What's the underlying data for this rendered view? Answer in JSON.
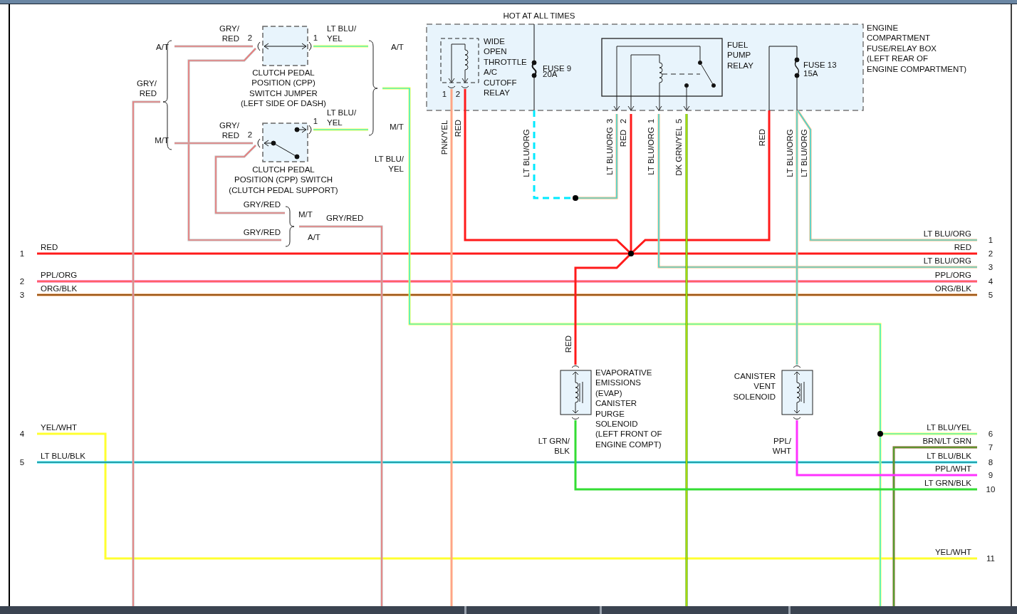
{
  "power_label": "HOT AT ALL TIMES",
  "components": [
    {
      "lines": [
        "CLUTCH PEDAL",
        "POSITION (CPP)",
        "SWITCH JUMPER",
        "(LEFT SIDE OF DASH)"
      ]
    },
    {
      "lines": [
        "CLUTCH PEDAL",
        "POSITION (CPP) SWITCH",
        "(CLUTCH PEDAL SUPPORT)"
      ]
    },
    {
      "lines": [
        "WIDE",
        "OPEN",
        "THROTTLE",
        "A/C",
        "CUTOFF",
        "RELAY"
      ]
    },
    {
      "lines": [
        "FUEL",
        "PUMP",
        "RELAY"
      ]
    },
    {
      "lines": [
        "ENGINE",
        "COMPARTMENT",
        "FUSE/RELAY BOX",
        "(LEFT REAR OF",
        "ENGINE COMPARTMENT)"
      ]
    },
    {
      "lines": [
        "EVAPORATIVE",
        "EMISSIONS",
        "(EVAP)",
        "CANISTER",
        "PURGE",
        "SOLENOID",
        "(LEFT FRONT OF",
        "ENGINE COMPT)"
      ]
    },
    {
      "lines": [
        "CANISTER",
        "VENT",
        "SOLENOID"
      ]
    }
  ],
  "fuses": [
    {
      "name": "FUSE 9",
      "rating": "20A"
    },
    {
      "name": "FUSE 13",
      "rating": "15A"
    }
  ],
  "wire_labels": [
    {
      "lines": [
        "GRY/",
        "RED"
      ]
    },
    {
      "lines": [
        "LT BLU/",
        "YEL"
      ]
    },
    {
      "lines": [
        "GRY/",
        "RED"
      ]
    },
    {
      "lines": [
        "GRY/",
        "RED"
      ]
    },
    {
      "lines": [
        "LT BLU/",
        "YEL"
      ]
    },
    {
      "lines": [
        "LT BLU/",
        "YEL"
      ]
    },
    {
      "lines": [
        "GRY/RED"
      ]
    },
    {
      "lines": [
        "GRY/RED"
      ]
    },
    {
      "lines": [
        "GRY/RED"
      ]
    },
    {
      "lines": [
        "PNK/YEL"
      ]
    },
    {
      "lines": [
        "RED"
      ]
    },
    {
      "lines": [
        "LT BLU/ORG"
      ]
    },
    {
      "lines": [
        "LT BLU/ORG"
      ]
    },
    {
      "lines": [
        "RED"
      ]
    },
    {
      "lines": [
        "LT BLU/ORG"
      ]
    },
    {
      "lines": [
        "DK GRN/YEL"
      ]
    },
    {
      "lines": [
        "RED"
      ]
    },
    {
      "lines": [
        "LT BLU/ORG"
      ]
    },
    {
      "lines": [
        "LT BLU/ORG"
      ]
    },
    {
      "lines": [
        "RED"
      ]
    },
    {
      "lines": [
        "LT GRN/",
        "BLK"
      ]
    },
    {
      "lines": [
        "PPL/",
        "WHT"
      ]
    }
  ],
  "pin_numbers": [
    "2",
    "1",
    "2",
    "1",
    "1",
    "2",
    "3",
    "2",
    "1",
    "5"
  ],
  "transmission_labels": [
    "A/T",
    "M/T",
    "A/T",
    "M/T",
    "M/T",
    "A/T"
  ],
  "left_connectors": [
    {
      "number": "1",
      "wire": "RED"
    },
    {
      "number": "2",
      "wire": "PPL/ORG"
    },
    {
      "number": "3",
      "wire": "ORG/BLK"
    },
    {
      "number": "4",
      "wire": "YEL/WHT"
    },
    {
      "number": "5",
      "wire": "LT BLU/BLK"
    }
  ],
  "right_connectors": [
    {
      "number": "1",
      "wire": "LT BLU/ORG"
    },
    {
      "number": "2",
      "wire": "RED"
    },
    {
      "number": "3",
      "wire": "LT BLU/ORG"
    },
    {
      "number": "4",
      "wire": "PPL/ORG"
    },
    {
      "number": "5",
      "wire": "ORG/BLK"
    },
    {
      "number": "6",
      "wire": "LT BLU/YEL"
    },
    {
      "number": "7",
      "wire": "BRN/LT GRN"
    },
    {
      "number": "8",
      "wire": "LT BLU/BLK"
    },
    {
      "number": "9",
      "wire": "PPL/WHT"
    },
    {
      "number": "10",
      "wire": "LT GRN/BLK"
    },
    {
      "number": "11",
      "wire": "YEL/WHT"
    }
  ]
}
